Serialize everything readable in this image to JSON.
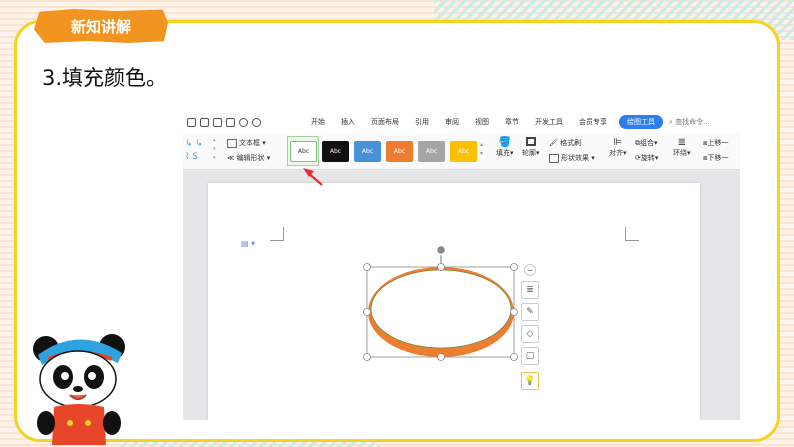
{
  "badge": {
    "label": "新知讲解"
  },
  "heading": {
    "text": "3.填充颜色。"
  },
  "menubar": {
    "tabs": [
      "开始",
      "插入",
      "页面布局",
      "引用",
      "审阅",
      "视图",
      "章节",
      "开发工具",
      "会员专享"
    ],
    "active_tab": "绘图工具",
    "search": "查找命令..."
  },
  "ribbon": {
    "text_box_label": "文本框",
    "edit_shape_label": "编辑形状",
    "style_samples": [
      {
        "text": "Abc",
        "fill": "#ffffff",
        "color": "#333333",
        "border": "#7fbf7b"
      },
      {
        "text": "Abc",
        "fill": "#111111",
        "color": "#ffffff",
        "border": "#111111"
      },
      {
        "text": "Abc",
        "fill": "#4a90d9",
        "color": "#ffffff",
        "border": "#4a90d9"
      },
      {
        "text": "Abc",
        "fill": "#ed7d31",
        "color": "#ffffff",
        "border": "#ed7d31"
      },
      {
        "text": "Abc",
        "fill": "#a5a5a5",
        "color": "#ffffff",
        "border": "#a5a5a5"
      },
      {
        "text": "Abc",
        "fill": "#ffc000",
        "color": "#ffffff",
        "border": "#ffc000"
      }
    ],
    "fill_label": "填充",
    "outline_label": "轮廓",
    "format_brush_label": "格式刷",
    "shape_effect_label": "形状效果",
    "align_label": "对齐",
    "group_label": "组合",
    "rotate_label": "旋转",
    "wrap_label": "环绕",
    "bring_forward_label": "上移一",
    "send_backward_label": "下移一"
  },
  "colors": {
    "ellipse_fill": "#ed7d31",
    "ellipse_inner": "#ffffff",
    "accent_blue": "#2f7ef0",
    "arrow_red": "#e03030",
    "card_border": "#f5d31f",
    "tag_orange": "#f29520"
  }
}
